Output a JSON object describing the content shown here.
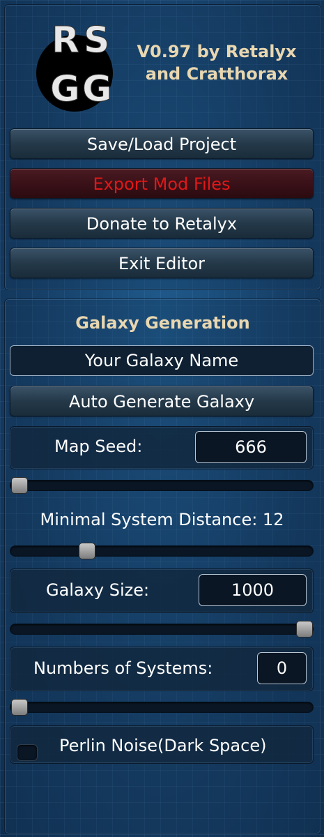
{
  "header": {
    "logo_text": "RSGG",
    "version_line1": "V0.97 by Retalyx",
    "version_line2": "and Cratthorax"
  },
  "menu": {
    "save_load": "Save/Load Project",
    "export": "Export Mod Files",
    "donate": "Donate to Retalyx",
    "exit": "Exit Editor"
  },
  "colors": {
    "export_text": "#e01818",
    "accent_text": "#e9d7b0"
  },
  "generation": {
    "title": "Galaxy Generation",
    "galaxy_name": "Your Galaxy Name",
    "auto_generate": "Auto Generate Galaxy",
    "map_seed_label": "Map Seed:",
    "map_seed_value": "666",
    "map_seed_slider": 0.0,
    "min_distance_label": "Minimal System Distance: 12",
    "min_distance_slider": 0.25,
    "galaxy_size_label": "Galaxy Size:",
    "galaxy_size_value": "1000",
    "galaxy_size_slider": 1.0,
    "systems_label": "Numbers of Systems:",
    "systems_value": "0",
    "systems_slider": 0.0,
    "perlin_label": "Perlin Noise(Dark Space)",
    "perlin_enabled": false
  }
}
